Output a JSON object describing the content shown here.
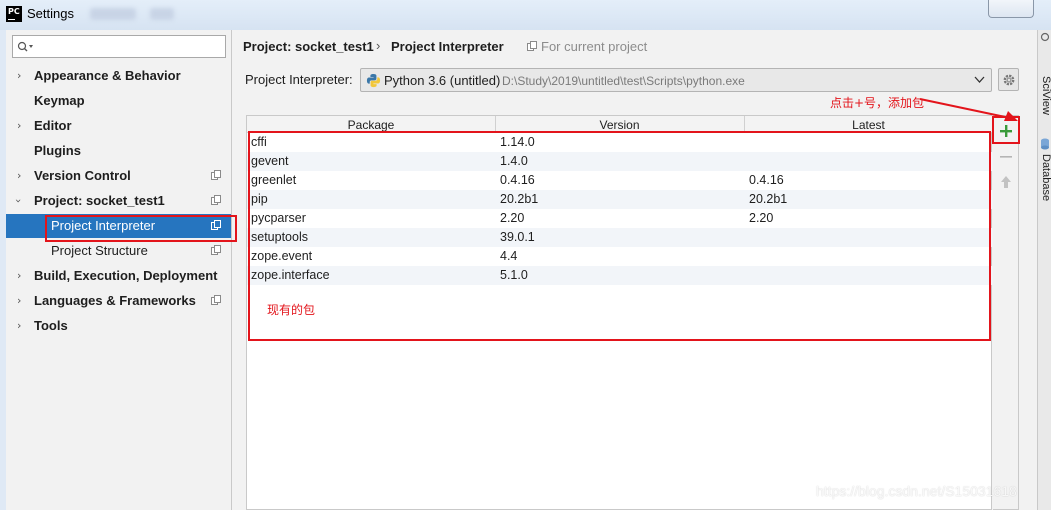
{
  "window": {
    "title": "Settings",
    "app_icon_text": "PC"
  },
  "sidebar": {
    "search_placeholder": "",
    "items": [
      {
        "label": "Appearance & Behavior"
      },
      {
        "label": "Keymap"
      },
      {
        "label": "Editor"
      },
      {
        "label": "Plugins"
      },
      {
        "label": "Version Control"
      },
      {
        "label": "Project: socket_test1"
      },
      {
        "label": "Project Interpreter"
      },
      {
        "label": "Project Structure"
      },
      {
        "label": "Build, Execution, Deployment"
      },
      {
        "label": "Languages & Frameworks"
      },
      {
        "label": "Tools"
      }
    ]
  },
  "breadcrumb": {
    "project": "Project: socket_test1",
    "separator": "›",
    "page": "Project Interpreter",
    "note": "For current project"
  },
  "interpreter": {
    "label": "Project Interpreter:",
    "name": "Python 3.6 (untitled)",
    "path": "D:\\Study\\2019\\untitled\\test\\Scripts\\python.exe"
  },
  "annotations": {
    "add_hint": "点击+号，添加包",
    "existing_packages": "现有的包"
  },
  "table": {
    "headers": [
      "Package",
      "Version",
      "Latest"
    ],
    "rows": [
      {
        "package": "cffi",
        "version": "1.14.0",
        "latest": ""
      },
      {
        "package": "gevent",
        "version": "1.4.0",
        "latest": ""
      },
      {
        "package": "greenlet",
        "version": "0.4.16",
        "latest": "0.4.16"
      },
      {
        "package": "pip",
        "version": "20.2b1",
        "latest": "20.2b1"
      },
      {
        "package": "pycparser",
        "version": "2.20",
        "latest": "2.20"
      },
      {
        "package": "setuptools",
        "version": "39.0.1",
        "latest": ""
      },
      {
        "package": "zope.event",
        "version": "4.4",
        "latest": ""
      },
      {
        "package": "zope.interface",
        "version": "5.1.0",
        "latest": ""
      }
    ]
  },
  "right_tabs": [
    "SciView",
    "Database"
  ],
  "watermark": "https://blog.csdn.net/S15031618",
  "colors": {
    "selection": "#2675bf",
    "annotation_red": "#e3141b",
    "add_green": "#3a9a3a"
  }
}
